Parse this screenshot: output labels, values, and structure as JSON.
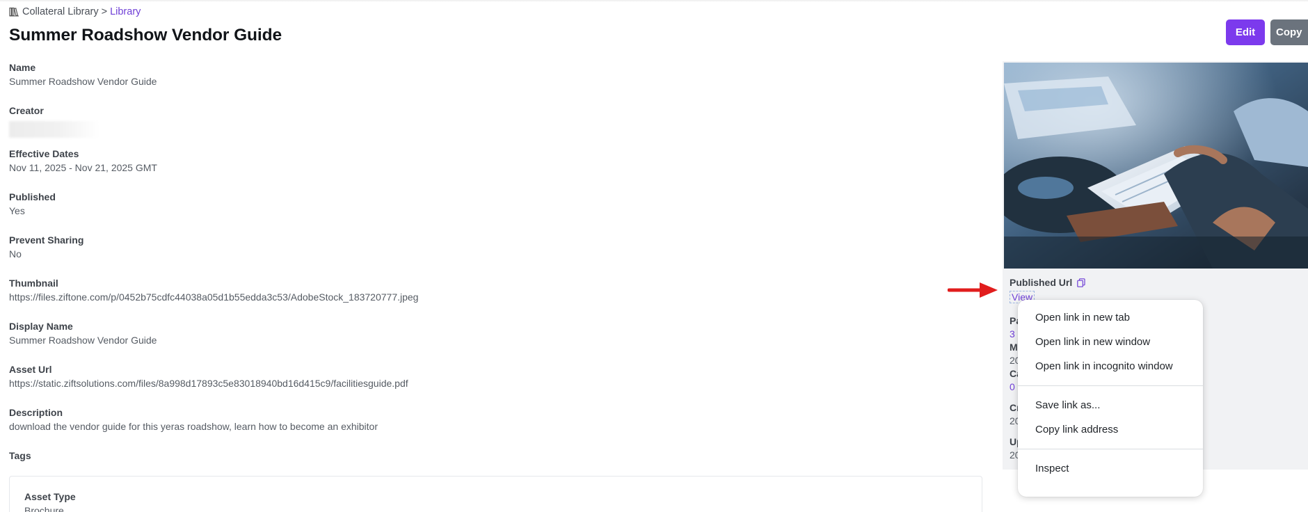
{
  "breadcrumb": {
    "root": "Collateral Library",
    "separator": ">",
    "current": "Library",
    "icon": "library-icon"
  },
  "page_title": "Summer Roadshow Vendor Guide",
  "toolbar": {
    "edit_label": "Edit",
    "copy_label": "Copy"
  },
  "fields": [
    {
      "label": "Name",
      "value": "Summer Roadshow Vendor Guide"
    },
    {
      "label": "Creator",
      "value": ""
    },
    {
      "label": "Effective Dates",
      "value": "Nov 11, 2025 - Nov 21, 2025 GMT"
    },
    {
      "label": "Published",
      "value": "Yes"
    },
    {
      "label": "Prevent Sharing",
      "value": "No"
    },
    {
      "label": "Thumbnail",
      "value": "https://files.ziftone.com/p/0452b75cdfc44038a05d1b55edda3c53/AdobeStock_183720777.jpeg"
    },
    {
      "label": "Display Name",
      "value": "Summer Roadshow Vendor Guide"
    },
    {
      "label": "Asset Url",
      "value": "https://static.ziftsolutions.com/files/8a998d17893c5e83018940bd16d415c9/facilitiesguide.pdf"
    },
    {
      "label": "Description",
      "value": "download the vendor guide for this yeras roadshow, learn how to become an exhibitor"
    }
  ],
  "tags": {
    "label": "Tags"
  },
  "asset_card": {
    "label": "Asset Type",
    "value": "Brochure"
  },
  "side": {
    "published_url_label": "Published Url",
    "view_label": "View",
    "truncated": {
      "pa": "Pa",
      "three": "3",
      "m": "M",
      "twenty_a": "20",
      "ca": "Ca",
      "zero": "0",
      "cr": "Cr",
      "twenty_b": "20",
      "up": "Up",
      "twenty_c": "20"
    }
  },
  "context_menu": {
    "group1": [
      "Open link in new tab",
      "Open link in new window",
      "Open link in incognito window"
    ],
    "group2": [
      "Save link as...",
      "Copy link address"
    ],
    "group3": [
      "Inspect"
    ]
  },
  "colors": {
    "accent": "#7c3aed",
    "link": "#6f3fd6",
    "copy_button": "#6b737d",
    "annotation_arrow": "#e11d1d"
  }
}
